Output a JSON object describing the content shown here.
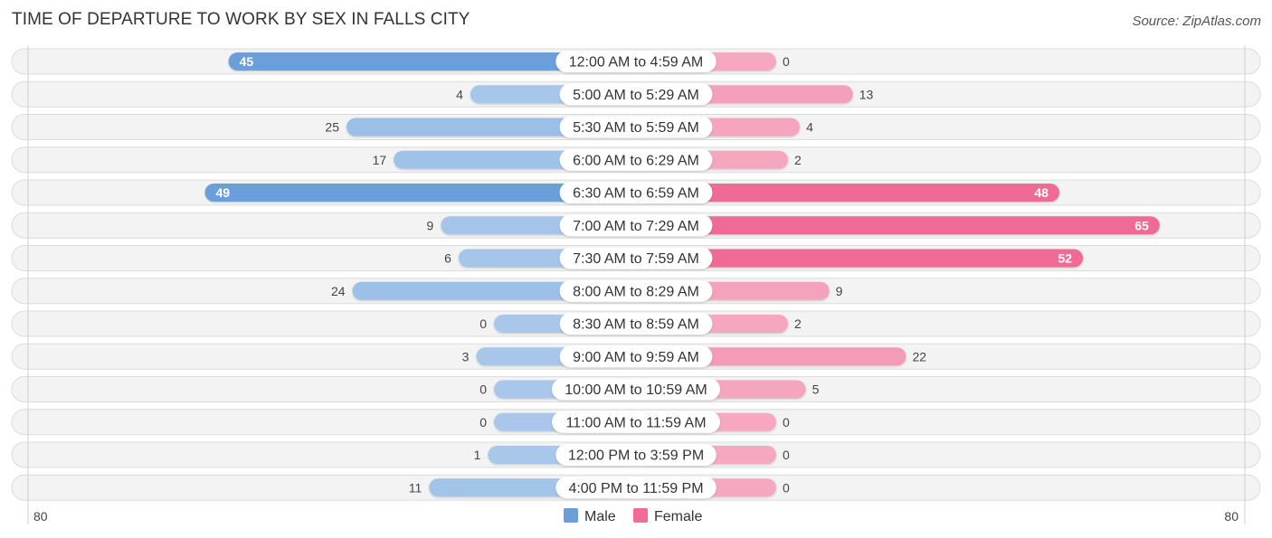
{
  "header": {
    "title": "TIME OF DEPARTURE TO WORK BY SEX IN FALLS CITY",
    "source": "Source: ZipAtlas.com"
  },
  "chart_data": {
    "type": "bar",
    "orientation": "horizontal-diverging",
    "title": "TIME OF DEPARTURE TO WORK BY SEX IN FALLS CITY",
    "source": "Source: ZipAtlas.com",
    "categories": [
      "12:00 AM to 4:59 AM",
      "5:00 AM to 5:29 AM",
      "5:30 AM to 5:59 AM",
      "6:00 AM to 6:29 AM",
      "6:30 AM to 6:59 AM",
      "7:00 AM to 7:29 AM",
      "7:30 AM to 7:59 AM",
      "8:00 AM to 8:29 AM",
      "8:30 AM to 8:59 AM",
      "9:00 AM to 9:59 AM",
      "10:00 AM to 10:59 AM",
      "11:00 AM to 11:59 AM",
      "12:00 PM to 3:59 PM",
      "4:00 PM to 11:59 PM"
    ],
    "series": [
      {
        "name": "Male",
        "color": "#6a9fdb",
        "color_light": "#a8c7ea",
        "values": [
          45,
          4,
          25,
          17,
          49,
          9,
          6,
          24,
          0,
          3,
          0,
          0,
          1,
          11
        ]
      },
      {
        "name": "Female",
        "color": "#f06b96",
        "color_light": "#f5a8c0",
        "values": [
          0,
          13,
          4,
          2,
          48,
          65,
          52,
          9,
          2,
          22,
          5,
          0,
          0,
          0
        ]
      }
    ],
    "axis": {
      "left_label": "80",
      "right_label": "80",
      "max": 80
    },
    "legend": {
      "position": "bottom-center",
      "items": [
        "Male",
        "Female"
      ]
    },
    "grid": false
  }
}
